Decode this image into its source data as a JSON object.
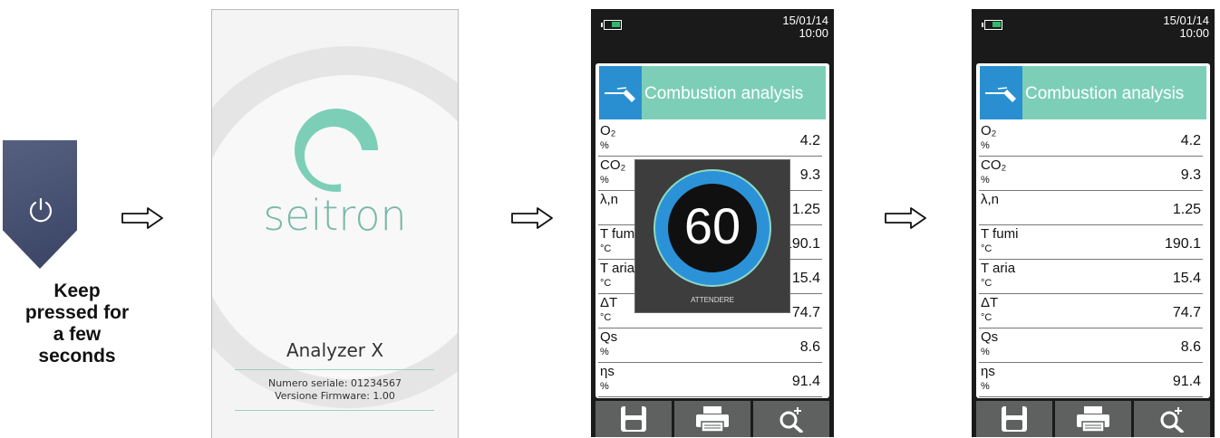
{
  "power": {
    "icon": "power-icon",
    "caption": [
      "Keep",
      "pressed for",
      "a few",
      "seconds"
    ]
  },
  "splash": {
    "brand": "seitron",
    "model": "Analyzer X",
    "serial": "Numero seriale: 01234567",
    "firmware": "Versione Firmware: 1.00"
  },
  "screen": {
    "date": "15/01/14",
    "time": "10:00",
    "title": "Combustion analysis",
    "rows": [
      {
        "label": "O₂",
        "unit": "%",
        "value": "4.2"
      },
      {
        "label": "CO₂",
        "unit": "%",
        "value": "9.3"
      },
      {
        "label": "λ,n",
        "unit": "",
        "value": "1.25"
      },
      {
        "label": "T fumi",
        "unit": "°C",
        "value": "190.1"
      },
      {
        "label": "T aria",
        "unit": "°C",
        "value": "15.4"
      },
      {
        "label": "ΔT",
        "unit": "°C",
        "value": "74.7"
      },
      {
        "label": "Qs",
        "unit": "%",
        "value": "8.6"
      },
      {
        "label": "ηs",
        "unit": "%",
        "value": "91.4"
      }
    ],
    "footer_icons": [
      "save-icon",
      "print-icon",
      "zoom-in-icon"
    ]
  },
  "countdown": {
    "number": "60",
    "text": "ATTENDERE"
  },
  "colors": {
    "accent": "#7ccfb6",
    "icon_blue": "#2a8fd0",
    "ring_blue": "#2b92d8"
  }
}
